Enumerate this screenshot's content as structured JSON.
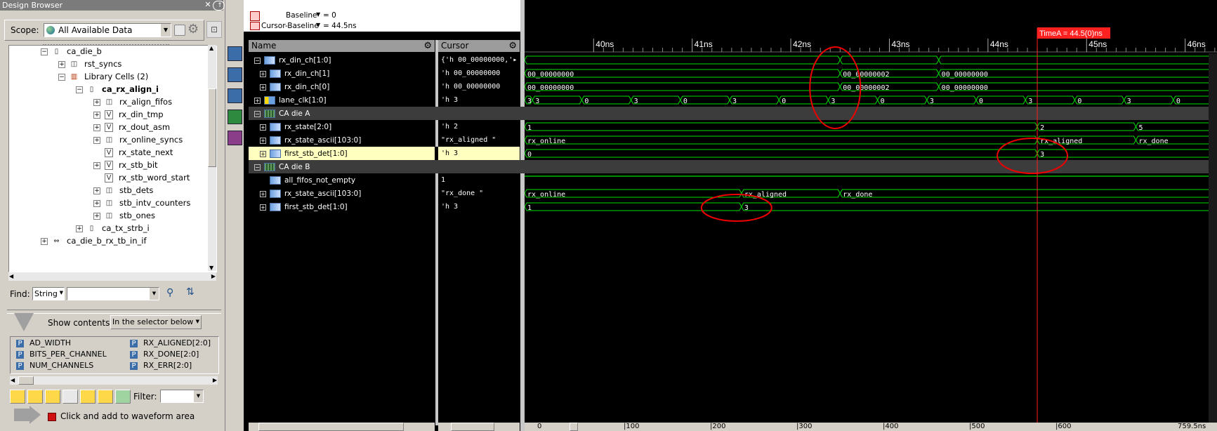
{
  "design_browser": {
    "title": "Design Browser",
    "scope_label": "Scope:",
    "scope_value": "All Available Data",
    "tree": [
      {
        "label": "ca_die_b",
        "expander": "−",
        "icon": "module-icon"
      },
      {
        "label": "rst_syncs",
        "expander": "+",
        "icon": "instance-icon"
      },
      {
        "label": "Library Cells (2)",
        "expander": "−",
        "icon": "library-icon"
      },
      {
        "label": "ca_rx_align_i",
        "expander": "−",
        "icon": "module-icon"
      },
      {
        "label": "rx_align_fifos",
        "expander": "+",
        "icon": "instance-icon"
      },
      {
        "label": "rx_din_tmp",
        "expander": "+",
        "icon": "verilog-icon"
      },
      {
        "label": "rx_dout_asm",
        "expander": "+",
        "icon": "verilog-icon"
      },
      {
        "label": "rx_online_syncs",
        "expander": "+",
        "icon": "instance-icon"
      },
      {
        "label": "rx_state_next",
        "expander": "",
        "icon": "verilog-icon"
      },
      {
        "label": "rx_stb_bit",
        "expander": "+",
        "icon": "verilog-icon"
      },
      {
        "label": "rx_stb_word_start",
        "expander": "",
        "icon": "verilog-icon"
      },
      {
        "label": "stb_dets",
        "expander": "+",
        "icon": "instance-icon"
      },
      {
        "label": "stb_intv_counters",
        "expander": "+",
        "icon": "instance-icon"
      },
      {
        "label": "stb_ones",
        "expander": "+",
        "icon": "instance-icon"
      },
      {
        "label": "ca_tx_strb_i",
        "expander": "+",
        "icon": "module-icon"
      },
      {
        "label": "ca_die_b_rx_tb_in_if",
        "expander": "+",
        "icon": "interface-icon"
      }
    ],
    "find_label": "Find:",
    "find_type": "String",
    "show_contents_label": "Show contents:",
    "show_contents_value": "In the selector below",
    "params": [
      "AD_WIDTH",
      "RX_ALIGNED[2:0]",
      "BITS_PER_CHANNEL",
      "RX_DONE[2:0]",
      "NUM_CHANNELS",
      "RX_ERR[2:0]"
    ],
    "filter_label": "Filter:",
    "hint": "Click and add to waveform area"
  },
  "waveform": {
    "baseline_label": "Baseline",
    "baseline_value": "= 0",
    "cursor_baseline_label": "Cursor-Baseline",
    "cursor_baseline_value": "= 44.5ns",
    "name_header": "Name",
    "cursor_header": "Cursor",
    "cursor_marker": "TimeA = 44.5(0)ns",
    "ticks": [
      "40ns",
      "41ns",
      "42ns",
      "43ns",
      "44ns",
      "45ns",
      "46ns"
    ],
    "signals": [
      {
        "name": "rx_din_ch[1:0]",
        "value": "{'h 00_00000000,'▸",
        "indent": 0,
        "expander": "−",
        "kind": "bus"
      },
      {
        "name": "rx_din_ch[1]",
        "value": "'h 00_00000000",
        "indent": 1,
        "expander": "+",
        "kind": "bus"
      },
      {
        "name": "rx_din_ch[0]",
        "value": "'h 00_00000000",
        "indent": 1,
        "expander": "+",
        "kind": "bus"
      },
      {
        "name": "lane_clk[1:0]",
        "value": "'h 3",
        "indent": 0,
        "expander": "+",
        "kind": "clk"
      },
      {
        "name": "CA die A",
        "value": "",
        "indent": 0,
        "expander": "−",
        "kind": "group"
      },
      {
        "name": "rx_state[2:0]",
        "value": "'h 2",
        "indent": 1,
        "expander": "+",
        "kind": "bus"
      },
      {
        "name": "rx_state_ascii[103:0]",
        "value": "\"rx_aligned   \"",
        "indent": 1,
        "expander": "+",
        "kind": "bus"
      },
      {
        "name": "first_stb_det[1:0]",
        "value": "'h 3",
        "indent": 1,
        "expander": "+",
        "kind": "bus",
        "selected": true
      },
      {
        "name": "CA die B",
        "value": "",
        "indent": 0,
        "expander": "−",
        "kind": "group"
      },
      {
        "name": "all_fifos_not_empty",
        "value": "1",
        "indent": 1,
        "expander": "",
        "kind": "bit"
      },
      {
        "name": "rx_state_ascii[103:0]",
        "value": "\"rx_done      \"",
        "indent": 1,
        "expander": "+",
        "kind": "bus"
      },
      {
        "name": "first_stb_det[1:0]",
        "value": "'h 3",
        "indent": 1,
        "expander": "+",
        "kind": "bus"
      }
    ],
    "row_waves": [
      {
        "segments": [
          {
            "t0": 39.3,
            "t1": 42.5,
            "label": ""
          },
          {
            "t0": 42.5,
            "t1": 43.5,
            "label": ""
          },
          {
            "t0": 43.5,
            "t1": 46.3,
            "label": ""
          }
        ]
      },
      {
        "segments": [
          {
            "t0": 39.3,
            "t1": 42.5,
            "label": "00_00000000"
          },
          {
            "t0": 42.5,
            "t1": 43.5,
            "label": "00_00000002"
          },
          {
            "t0": 43.5,
            "t1": 46.3,
            "label": "00_00000000"
          }
        ]
      },
      {
        "segments": [
          {
            "t0": 39.3,
            "t1": 42.5,
            "label": "00_00000000"
          },
          {
            "t0": 42.5,
            "t1": 43.5,
            "label": "00_00000002"
          },
          {
            "t0": 43.5,
            "t1": 46.3,
            "label": "00_00000000"
          }
        ]
      },
      {
        "segments": [
          {
            "t0": 39.3,
            "t1": 39.38,
            "label": "3"
          },
          {
            "t0": 39.38,
            "t1": 39.88,
            "label": "3"
          },
          {
            "t0": 39.88,
            "t1": 40.38,
            "label": "0"
          },
          {
            "t0": 40.38,
            "t1": 40.88,
            "label": "3"
          },
          {
            "t0": 40.88,
            "t1": 41.38,
            "label": "0"
          },
          {
            "t0": 41.38,
            "t1": 41.88,
            "label": "3"
          },
          {
            "t0": 41.88,
            "t1": 42.38,
            "label": "0"
          },
          {
            "t0": 42.38,
            "t1": 42.88,
            "label": "3"
          },
          {
            "t0": 42.88,
            "t1": 43.38,
            "label": "0"
          },
          {
            "t0": 43.38,
            "t1": 43.88,
            "label": "3"
          },
          {
            "t0": 43.88,
            "t1": 44.38,
            "label": "0"
          },
          {
            "t0": 44.38,
            "t1": 44.88,
            "label": "3"
          },
          {
            "t0": 44.88,
            "t1": 45.38,
            "label": "0"
          },
          {
            "t0": 45.38,
            "t1": 45.88,
            "label": "3"
          },
          {
            "t0": 45.88,
            "t1": 46.3,
            "label": "0"
          }
        ]
      },
      {
        "segments": []
      },
      {
        "segments": [
          {
            "t0": 39.3,
            "t1": 44.5,
            "label": "1"
          },
          {
            "t0": 44.5,
            "t1": 45.5,
            "label": "2"
          },
          {
            "t0": 45.5,
            "t1": 46.3,
            "label": "5"
          }
        ]
      },
      {
        "segments": [
          {
            "t0": 39.3,
            "t1": 44.5,
            "label": "rx_online"
          },
          {
            "t0": 44.5,
            "t1": 45.5,
            "label": "rx_aligned"
          },
          {
            "t0": 45.5,
            "t1": 46.3,
            "label": "rx_done"
          }
        ]
      },
      {
        "segments": [
          {
            "t0": 39.3,
            "t1": 44.5,
            "label": "0"
          },
          {
            "t0": 44.5,
            "t1": 46.3,
            "label": "3"
          }
        ]
      },
      {
        "segments": []
      },
      {
        "segments": [
          {
            "t0": 39.3,
            "t1": 46.3,
            "label": "",
            "high": true
          }
        ]
      },
      {
        "segments": [
          {
            "t0": 39.3,
            "t1": 41.5,
            "label": "rx_online"
          },
          {
            "t0": 41.5,
            "t1": 42.5,
            "label": "rx_aligned"
          },
          {
            "t0": 42.5,
            "t1": 46.3,
            "label": "rx_done"
          }
        ]
      },
      {
        "segments": [
          {
            "t0": 39.3,
            "t1": 41.5,
            "label": "1"
          },
          {
            "t0": 41.5,
            "t1": 46.3,
            "label": "3"
          }
        ]
      }
    ],
    "bottom_ticks": [
      "0",
      "100",
      "200",
      "300",
      "400",
      "500",
      "600",
      "759.5ns"
    ]
  },
  "colors": {
    "wave": "#00e000",
    "cursor": "#ff2020",
    "group_bg": "#3c3c3c",
    "selected_bg": "#ffffc0"
  }
}
